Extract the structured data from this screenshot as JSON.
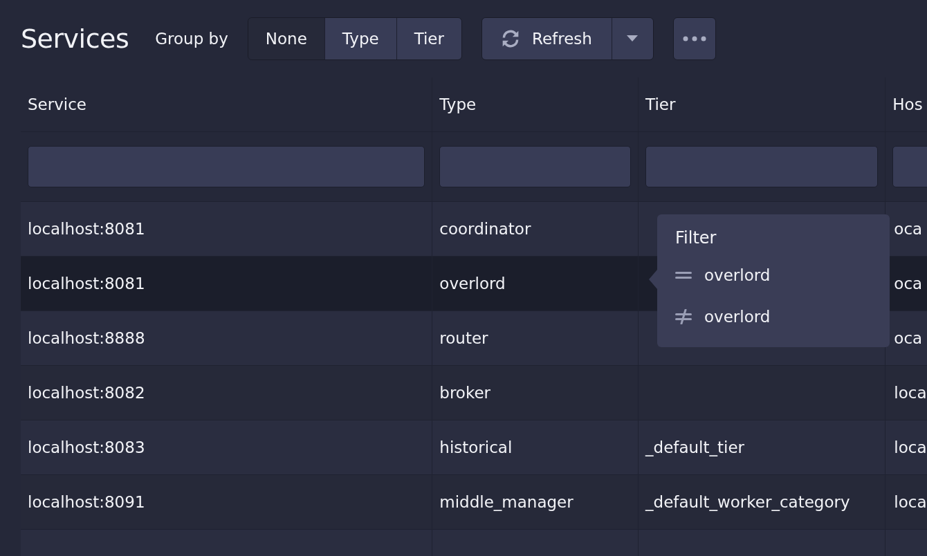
{
  "title": "Services",
  "group_by": {
    "label": "Group by",
    "options": [
      {
        "label": "None",
        "selected": true
      },
      {
        "label": "Type",
        "selected": false
      },
      {
        "label": "Tier",
        "selected": false
      }
    ]
  },
  "refresh_button": {
    "label": "Refresh"
  },
  "table": {
    "columns": [
      "Service",
      "Type",
      "Tier",
      "Hos"
    ],
    "rows": [
      {
        "cells": [
          "localhost:8081",
          "coordinator",
          "",
          "oca"
        ],
        "hovered": false
      },
      {
        "cells": [
          "localhost:8081",
          "overlord",
          "",
          "oca"
        ],
        "hovered": true
      },
      {
        "cells": [
          "localhost:8888",
          "router",
          "",
          "oca"
        ],
        "hovered": false
      },
      {
        "cells": [
          "localhost:8082",
          "broker",
          "",
          "loca"
        ],
        "hovered": false
      },
      {
        "cells": [
          "localhost:8083",
          "historical",
          "_default_tier",
          "loca"
        ],
        "hovered": false
      },
      {
        "cells": [
          "localhost:8091",
          "middle_manager",
          "_default_worker_category",
          "loca"
        ],
        "hovered": false
      }
    ]
  },
  "filter_popover": {
    "title": "Filter",
    "items": [
      {
        "kind": "equals",
        "value": "overlord"
      },
      {
        "kind": "not_equals",
        "value": "overlord"
      }
    ]
  }
}
